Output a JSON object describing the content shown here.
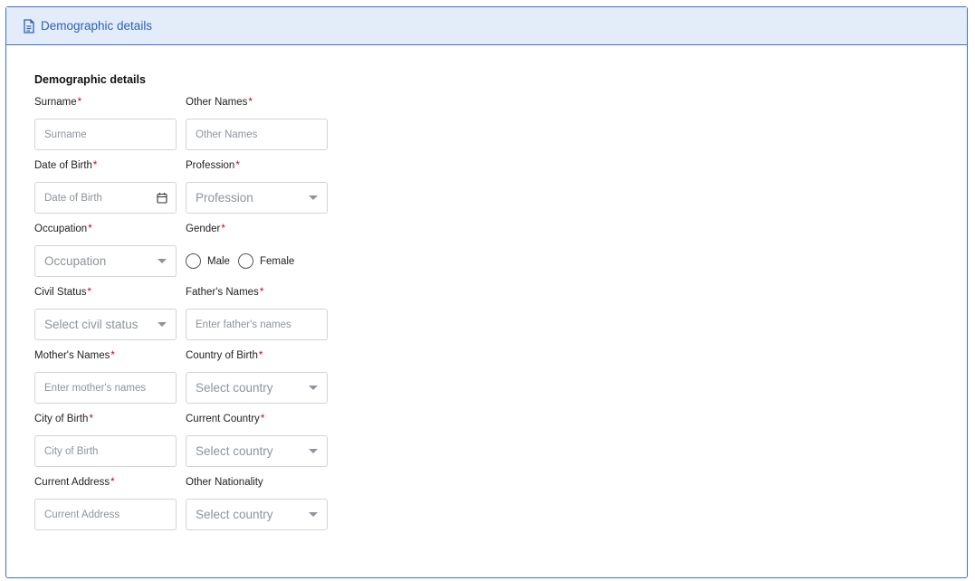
{
  "header": {
    "title": "Demographic details",
    "icon": "document-icon"
  },
  "section_title": "Demographic details",
  "fields": {
    "surname": {
      "label": "Surname",
      "placeholder": "Surname"
    },
    "other_names": {
      "label": "Other Names",
      "placeholder": "Other Names"
    },
    "date_of_birth": {
      "label": "Date of Birth",
      "placeholder": "Date of Birth"
    },
    "profession": {
      "label": "Profession",
      "selected": "Profession"
    },
    "occupation": {
      "label": "Occupation",
      "selected": "Occupation"
    },
    "gender": {
      "label": "Gender",
      "options": [
        "Male",
        "Female"
      ]
    },
    "civil_status": {
      "label": "Civil Status",
      "selected": "Select civil status"
    },
    "fathers_names": {
      "label": "Father's Names",
      "placeholder": "Enter father's names"
    },
    "mothers_names": {
      "label": "Mother's Names",
      "placeholder": "Enter mother's names"
    },
    "country_of_birth": {
      "label": "Country of Birth",
      "selected": "Select country"
    },
    "city_of_birth": {
      "label": "City of Birth",
      "placeholder": "City of Birth"
    },
    "current_country": {
      "label": "Current Country",
      "selected": "Select country"
    },
    "current_address": {
      "label": "Current Address",
      "placeholder": "Current Address"
    },
    "other_nationality": {
      "label": "Other Nationality",
      "selected": "Select country"
    }
  },
  "required_marker": "*",
  "colors": {
    "accent": "#3f6fcf",
    "header_bg": "#e3ecf9",
    "required": "#d0021b"
  }
}
